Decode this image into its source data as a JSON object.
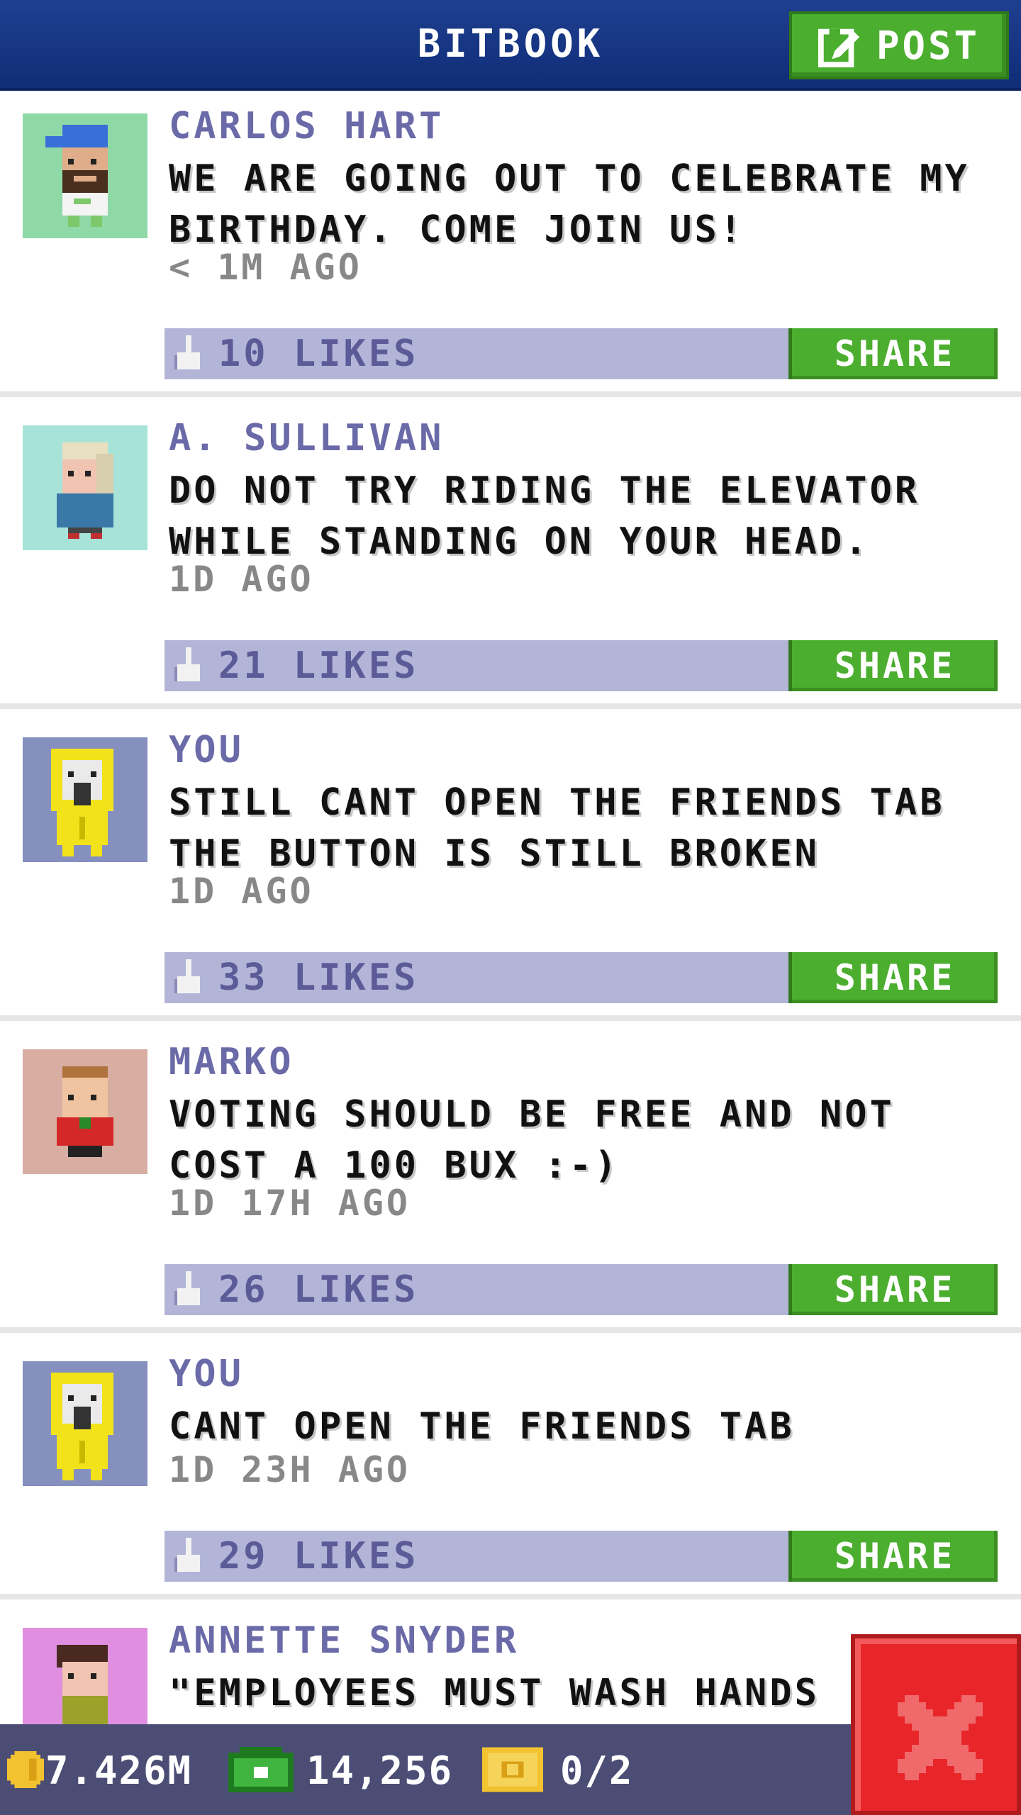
{
  "header": {
    "title": "BITBOOK",
    "post_label": "POST"
  },
  "posts": [
    {
      "author": "CARLOS HART",
      "message": "WE ARE GOING OUT TO CELEBRATE MY BIRTHDAY. COME JOIN US!",
      "time": "< 1M AGO",
      "likes": "10 LIKES",
      "share": "SHARE",
      "avatar_bg": "#8fd9a6"
    },
    {
      "author": "A. SULLIVAN",
      "message": "DO NOT TRY RIDING THE ELEVATOR WHILE STANDING ON YOUR HEAD.",
      "time": "1D AGO",
      "likes": "21 LIKES",
      "share": "SHARE",
      "avatar_bg": "#a7e3d9"
    },
    {
      "author": "YOU",
      "message": "STILL CANT OPEN THE FRIENDS TAB THE BUTTON IS STILL BROKEN",
      "time": "1D AGO",
      "likes": "33 LIKES",
      "share": "SHARE",
      "avatar_bg": "#8590bf"
    },
    {
      "author": "MARKO",
      "message": "VOTING SHOULD BE FREE AND NOT COST A 100 BUX :-)",
      "time": "1D 17H AGO",
      "likes": "26 LIKES",
      "share": "SHARE",
      "avatar_bg": "#d8aea3"
    },
    {
      "author": "YOU",
      "message": "CANT OPEN THE FRIENDS TAB",
      "time": "1D 23H AGO",
      "likes": "29 LIKES",
      "share": "SHARE",
      "avatar_bg": "#8590bf"
    },
    {
      "author": "ANNETTE SNYDER",
      "message": "\"EMPLOYEES MUST WASH HANDS",
      "avatar_bg": "#e08fe0"
    }
  ],
  "status": {
    "coins": "7.426M",
    "bux": "14,256",
    "tickets": "0/2"
  },
  "icons": {
    "post": "edit-icon",
    "like": "thumbs-up-icon",
    "coin": "coin-icon",
    "bux": "bux-icon",
    "ticket": "ticket-icon",
    "close": "close-icon"
  },
  "colors": {
    "header": "#1a3a8a",
    "accent_green": "#4cae2f",
    "likes_bar": "#b3b5d8",
    "author_text": "#6b6aa8",
    "close_red": "#e8262a"
  }
}
